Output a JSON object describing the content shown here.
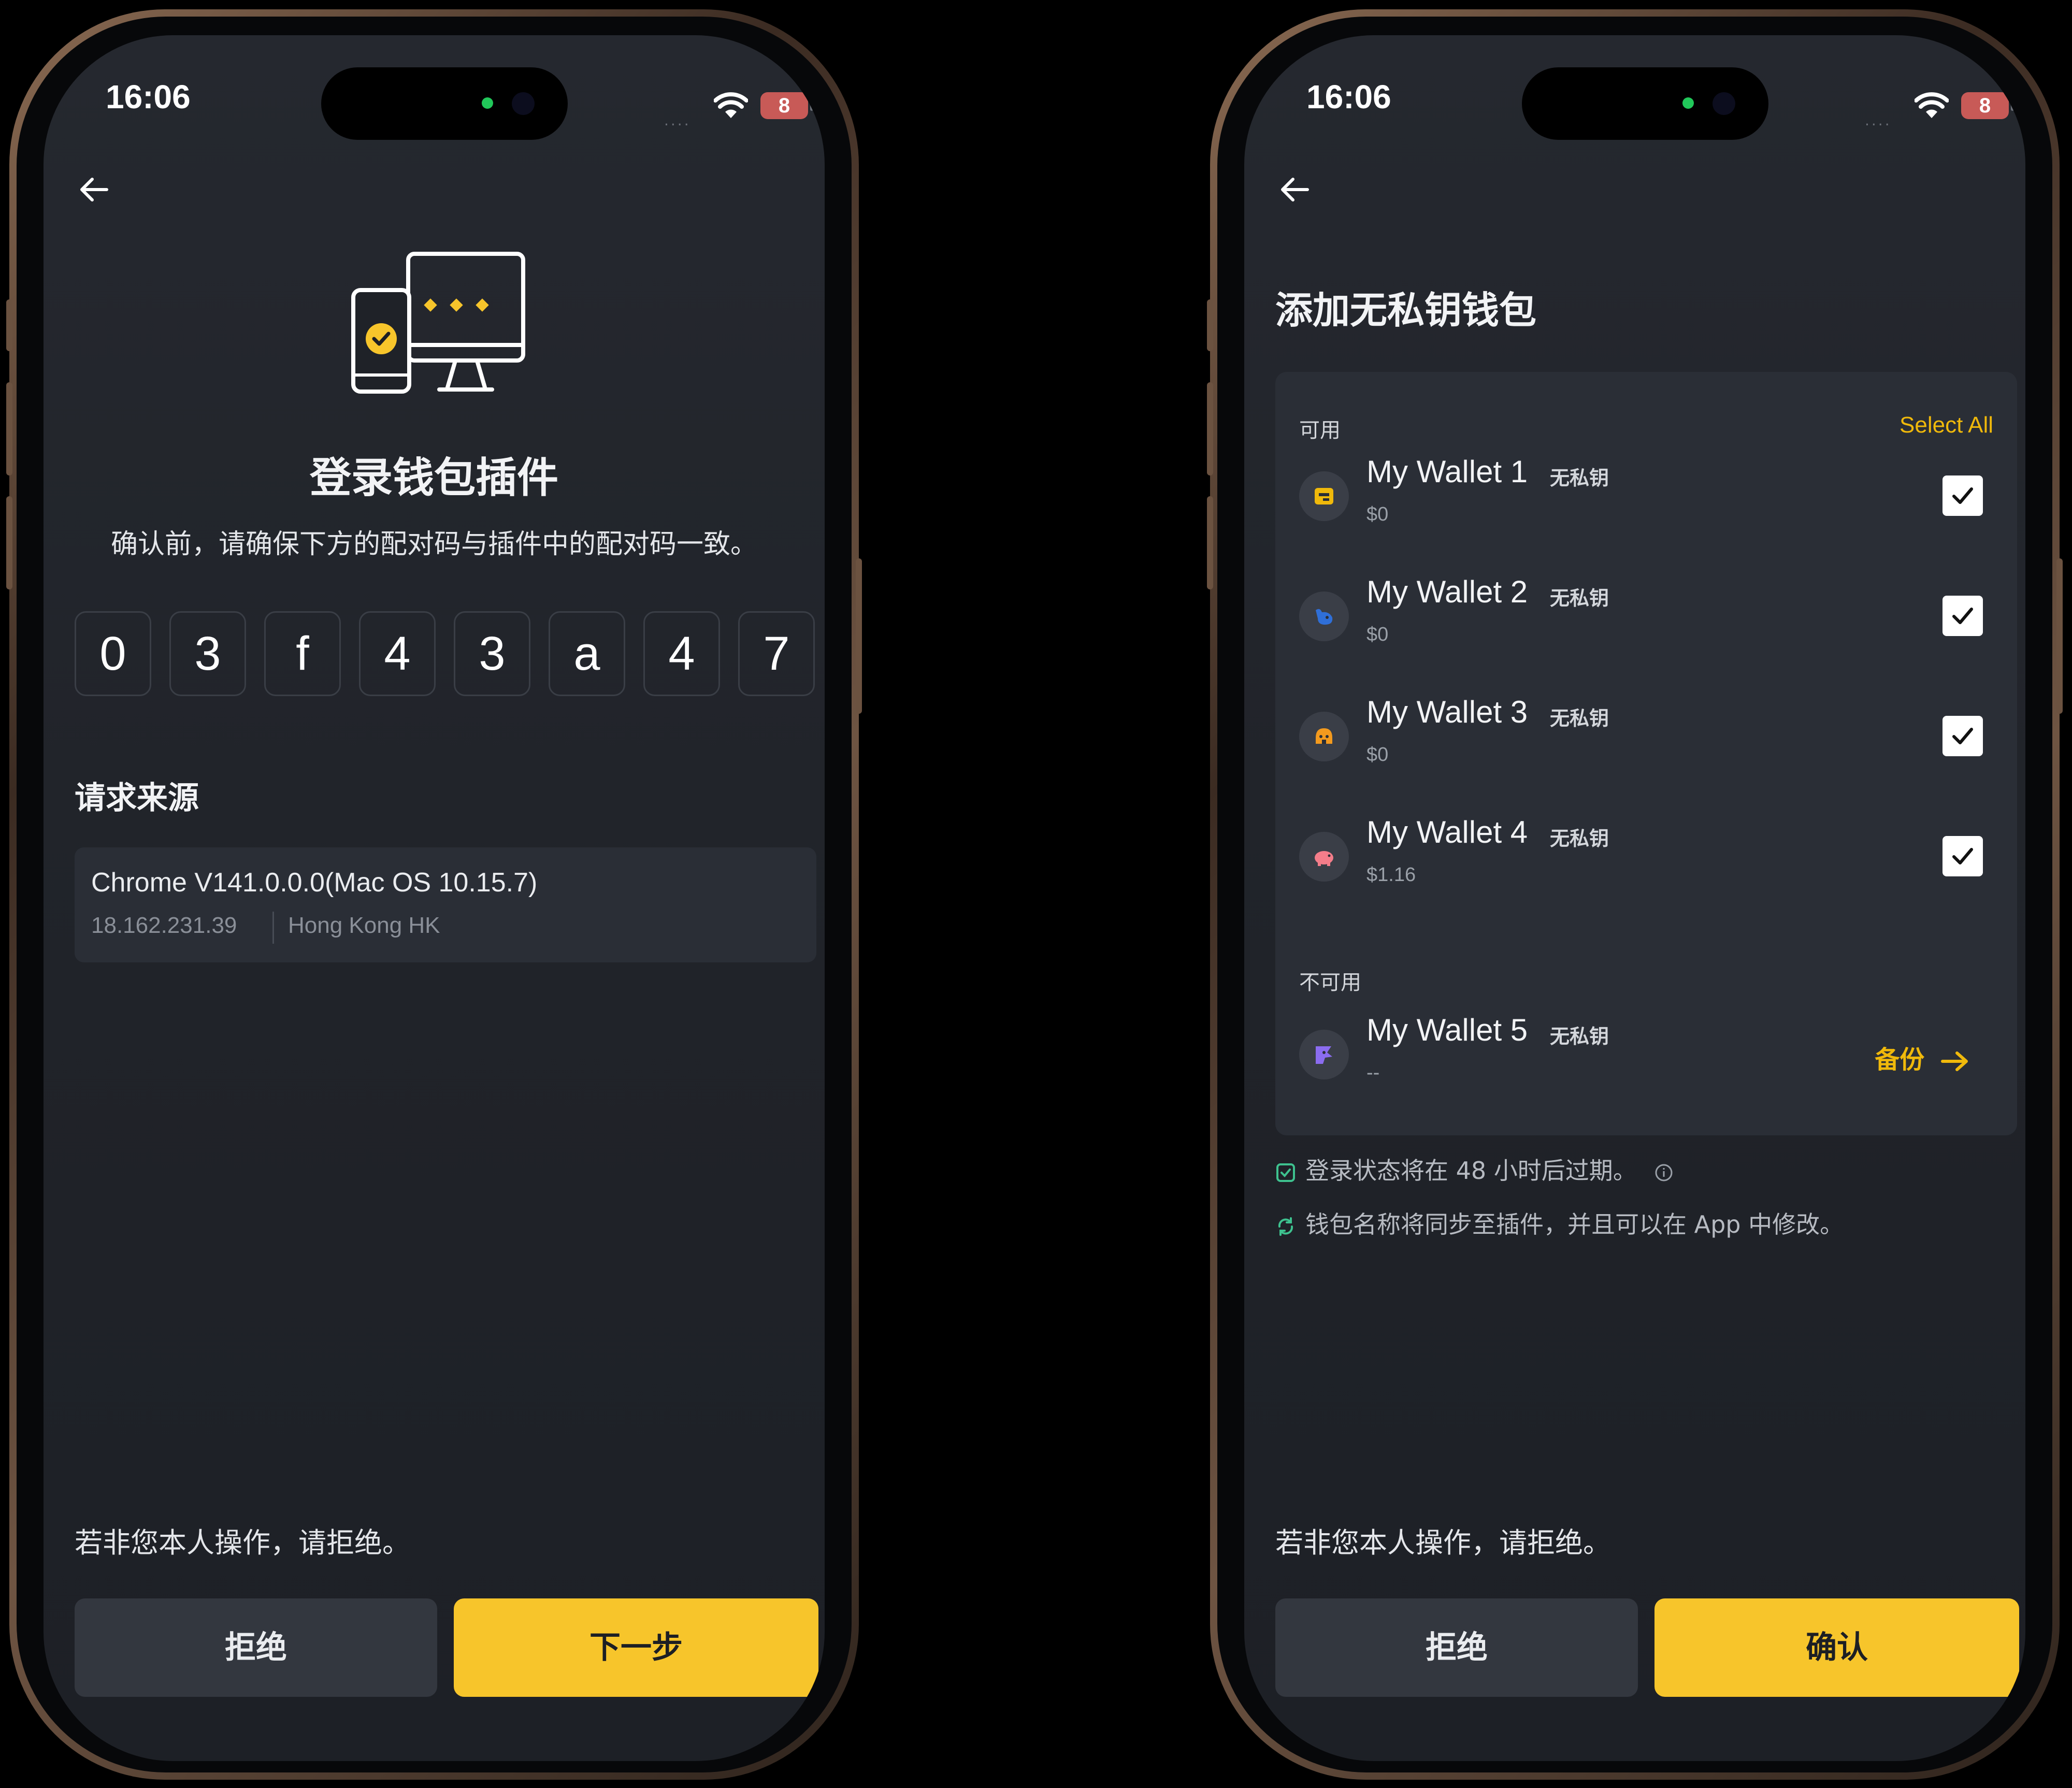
{
  "status": {
    "time": "16:06",
    "battery": "8",
    "signal_dots": "...."
  },
  "left": {
    "title": "登录钱包插件",
    "subtitle": "确认前，请确保下方的配对码与插件中的配对码一致。",
    "code": [
      "0",
      "3",
      "f",
      "4",
      "3",
      "a",
      "4",
      "7"
    ],
    "source_heading": "请求来源",
    "source": {
      "browser": "Chrome V141.0.0.0(Mac OS 10.15.7)",
      "ip": "18.162.231.39",
      "location": "Hong Kong HK"
    },
    "warning": "若非您本人操作，请拒绝。",
    "reject_label": "拒绝",
    "next_label": "下一步"
  },
  "right": {
    "title": "添加无私钥钱包",
    "available_label": "可用",
    "select_all_label": "Select All",
    "wallets": [
      {
        "name": "My Wallet 1",
        "tag": "无私钥",
        "balance": "$0",
        "checked": true,
        "icon": "wallet-icon-yellow",
        "color": "#f0b90b"
      },
      {
        "name": "My Wallet 2",
        "tag": "无私钥",
        "balance": "$0",
        "checked": true,
        "icon": "wallet-icon-blue",
        "color": "#2f6fd8"
      },
      {
        "name": "My Wallet 3",
        "tag": "无私钥",
        "balance": "$0",
        "checked": true,
        "icon": "wallet-icon-orange",
        "color": "#f39a1e"
      },
      {
        "name": "My Wallet 4",
        "tag": "无私钥",
        "balance": "$1.16",
        "checked": true,
        "icon": "wallet-icon-pink",
        "color": "#f47d8a"
      }
    ],
    "unavailable_label": "不可用",
    "unavailable_wallet": {
      "name": "My Wallet 5",
      "tag": "无私钥",
      "balance": "--",
      "backup_label": "备份",
      "icon": "wallet-icon-purple",
      "color": "#8b6cf0"
    },
    "note_expire": "登录状态将在 48 小时后过期。",
    "note_sync": "钱包名称将同步至插件，并且可以在 App 中修改。",
    "warning": "若非您本人操作，请拒绝。",
    "reject_label": "拒绝",
    "confirm_label": "确认"
  },
  "colors": {
    "accent": "#f7c52b",
    "link": "#f0b90b",
    "success": "#3ec28f",
    "card": "#2a2e36"
  }
}
